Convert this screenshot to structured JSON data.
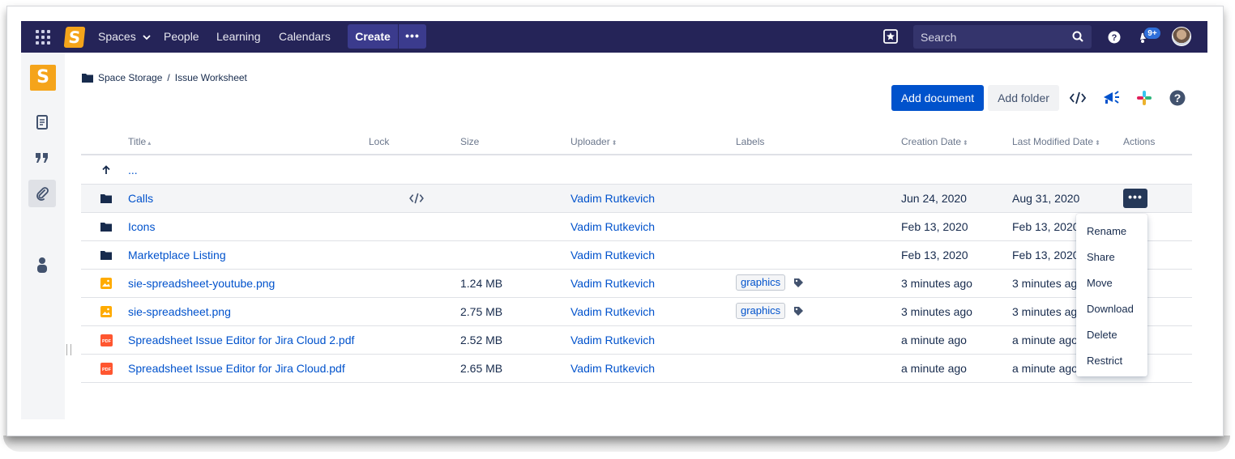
{
  "nav": {
    "logo_letter": "S",
    "spaces": "Spaces",
    "people": "People",
    "learning": "Learning",
    "calendars": "Calendars",
    "create": "Create",
    "more": "•••",
    "search_placeholder": "Search",
    "notifications_badge": "9+"
  },
  "sidebar": {
    "logo_letter": "S"
  },
  "breadcrumb": {
    "root": "Space Storage",
    "separator": "/",
    "current": "Issue Worksheet"
  },
  "toolbar": {
    "add_document": "Add document",
    "add_folder": "Add folder"
  },
  "table": {
    "headers": {
      "title": "Title",
      "title_sort": "▴",
      "lock": "Lock",
      "size": "Size",
      "uploader": "Uploader",
      "uploader_sort": "⬍",
      "labels": "Labels",
      "creation_date": "Creation Date",
      "creation_sort": "⬍",
      "last_modified": "Last Modified Date",
      "modified_sort": "⬍",
      "actions": "Actions"
    },
    "parent": {
      "label": "..."
    },
    "rows": [
      {
        "type": "folder",
        "title": "Calls",
        "size": "",
        "uploader": "Vadim Rutkevich",
        "label": "",
        "created": "Jun 24, 2020",
        "modified": "Aug 31, 2020"
      },
      {
        "type": "folder",
        "title": "Icons",
        "size": "",
        "uploader": "Vadim Rutkevich",
        "label": "",
        "created": "Feb 13, 2020",
        "modified": "Feb 13, 2020"
      },
      {
        "type": "folder",
        "title": "Marketplace Listing",
        "size": "",
        "uploader": "Vadim Rutkevich",
        "label": "",
        "created": "Feb 13, 2020",
        "modified": "Feb 13, 2020"
      },
      {
        "type": "image",
        "title": "sie-spreadsheet-youtube.png",
        "size": "1.24 MB",
        "uploader": "Vadim Rutkevich",
        "label": "graphics",
        "created": "3 minutes ago",
        "modified": "3 minutes ago"
      },
      {
        "type": "image",
        "title": "sie-spreadsheet.png",
        "size": "2.75 MB",
        "uploader": "Vadim Rutkevich",
        "label": "graphics",
        "created": "3 minutes ago",
        "modified": "3 minutes ago"
      },
      {
        "type": "pdf",
        "title": "Spreadsheet Issue Editor for Jira Cloud 2.pdf",
        "size": "2.52 MB",
        "uploader": "Vadim Rutkevich",
        "label": "",
        "created": "a minute ago",
        "modified": "a minute ago"
      },
      {
        "type": "pdf",
        "title": "Spreadsheet Issue Editor for Jira Cloud.pdf",
        "size": "2.65 MB",
        "uploader": "Vadim Rutkevich",
        "label": "",
        "created": "a minute ago",
        "modified": "a minute ago"
      }
    ],
    "pdf_icon_text": "PDF",
    "actions_label": "•••"
  },
  "menu": {
    "items": [
      "Rename",
      "Share",
      "Move",
      "Download",
      "Delete",
      "Restrict"
    ]
  },
  "colors": {
    "nav_bg": "#252458",
    "link": "#0052cc",
    "primary_button": "#0052cc",
    "logo": "#f5a41a"
  }
}
